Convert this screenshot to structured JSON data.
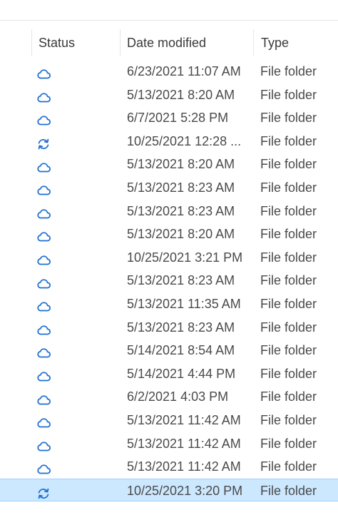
{
  "columns": {
    "status": "Status",
    "date_modified": "Date modified",
    "type": "Type"
  },
  "colors": {
    "accent": "#1f6fd1",
    "selected_bg": "#cce8ff",
    "selected_border": "#99d1ff"
  },
  "rows": [
    {
      "status_icon": "cloud-icon",
      "date": "6/23/2021 11:07 AM",
      "type": "File folder"
    },
    {
      "status_icon": "cloud-icon",
      "date": "5/13/2021 8:20 AM",
      "type": "File folder"
    },
    {
      "status_icon": "cloud-icon",
      "date": "6/7/2021 5:28 PM",
      "type": "File folder"
    },
    {
      "status_icon": "sync-icon",
      "date": "10/25/2021 12:28 ...",
      "type": "File folder"
    },
    {
      "status_icon": "cloud-icon",
      "date": "5/13/2021 8:20 AM",
      "type": "File folder"
    },
    {
      "status_icon": "cloud-icon",
      "date": "5/13/2021 8:23 AM",
      "type": "File folder"
    },
    {
      "status_icon": "cloud-icon",
      "date": "5/13/2021 8:23 AM",
      "type": "File folder"
    },
    {
      "status_icon": "cloud-icon",
      "date": "5/13/2021 8:20 AM",
      "type": "File folder"
    },
    {
      "status_icon": "cloud-icon",
      "date": "10/25/2021 3:21 PM",
      "type": "File folder"
    },
    {
      "status_icon": "cloud-icon",
      "date": "5/13/2021 8:23 AM",
      "type": "File folder"
    },
    {
      "status_icon": "cloud-icon",
      "date": "5/13/2021 11:35 AM",
      "type": "File folder"
    },
    {
      "status_icon": "cloud-icon",
      "date": "5/13/2021 8:23 AM",
      "type": "File folder"
    },
    {
      "status_icon": "cloud-icon",
      "date": "5/14/2021 8:54 AM",
      "type": "File folder"
    },
    {
      "status_icon": "cloud-icon",
      "date": "5/14/2021 4:44 PM",
      "type": "File folder"
    },
    {
      "status_icon": "cloud-icon",
      "date": "6/2/2021 4:03 PM",
      "type": "File folder"
    },
    {
      "status_icon": "cloud-icon",
      "date": "5/13/2021 11:42 AM",
      "type": "File folder"
    },
    {
      "status_icon": "cloud-icon",
      "date": "5/13/2021 11:42 AM",
      "type": "File folder"
    },
    {
      "status_icon": "cloud-icon",
      "date": "5/13/2021 11:42 AM",
      "type": "File folder"
    },
    {
      "status_icon": "sync-icon",
      "date": "10/25/2021 3:20 PM",
      "type": "File folder",
      "selected": true
    }
  ]
}
